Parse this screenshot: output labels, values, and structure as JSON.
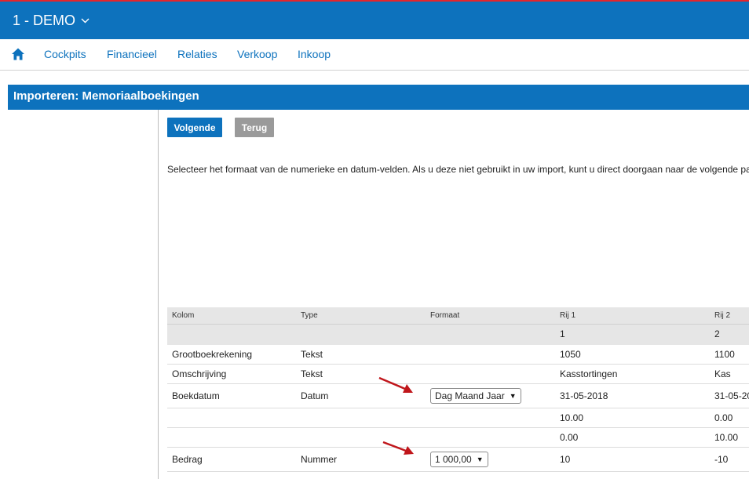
{
  "header": {
    "company": "1 - DEMO"
  },
  "nav": {
    "items": [
      "Cockpits",
      "Financieel",
      "Relaties",
      "Verkoop",
      "Inkoop"
    ]
  },
  "page": {
    "title": "Importeren: Memoriaalboekingen",
    "buttons": {
      "next": "Volgende",
      "back": "Terug"
    },
    "instruction": "Selecteer het formaat van de numerieke en datum-velden. Als u deze niet gebruikt in uw import, kunt u direct doorgaan naar de volgende pa"
  },
  "table": {
    "headers": [
      "Kolom",
      "Type",
      "Formaat",
      "Rij 1",
      "Rij 2"
    ],
    "subheader": [
      "",
      "",
      "",
      "1",
      "2"
    ],
    "rows": [
      [
        "Grootboekrekening",
        "Tekst",
        "",
        "1050",
        "1100"
      ],
      [
        "Omschrijving",
        "Tekst",
        "",
        "Kasstortingen",
        "Kas"
      ],
      [
        "Boekdatum",
        "Datum",
        "Dag Maand Jaar",
        "31-05-2018",
        "31-05-20"
      ],
      [
        "",
        "",
        "",
        "10.00",
        "0.00"
      ],
      [
        "",
        "",
        "",
        "0.00",
        "10.00"
      ],
      [
        "Bedrag",
        "Nummer",
        "1 000,00",
        "10",
        "-10"
      ]
    ]
  },
  "colors": {
    "brand": "#0d72bd",
    "accent_line": "#e3262d",
    "arrow": "#c0161b"
  }
}
